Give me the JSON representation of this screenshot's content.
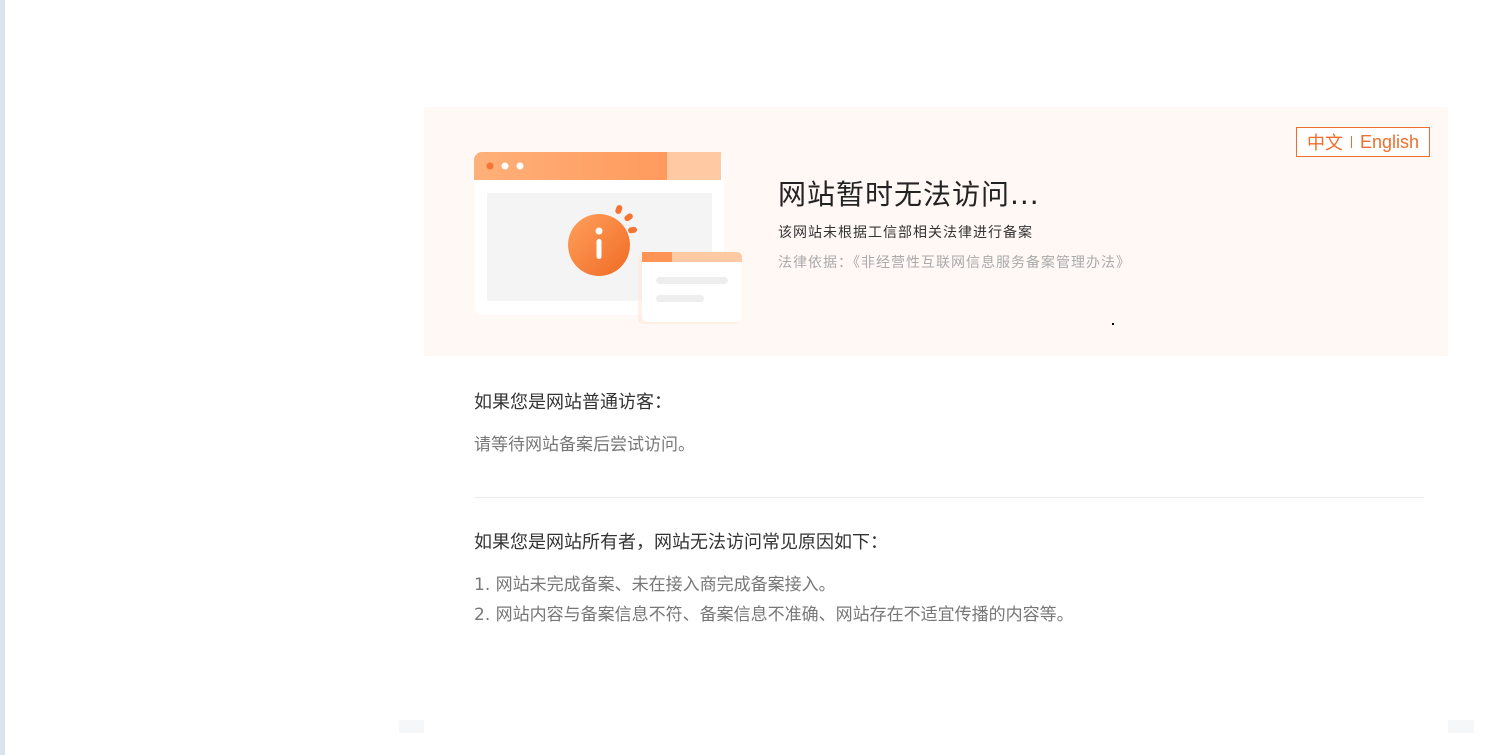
{
  "hero": {
    "title": "网站暂时无法访问...",
    "subtitle": "该网站未根据工信部相关法律进行备案",
    "law": "法律依据：《非经营性互联网信息服务备案管理办法》"
  },
  "lang": {
    "zh": "中文",
    "en": "English"
  },
  "visitor": {
    "title": "如果您是网站普通访客：",
    "body": "请等待网站备案后尝试访问。"
  },
  "owner": {
    "title": "如果您是网站所有者，网站无法访问常见原因如下：",
    "items": [
      "1. 网站未完成备案、未在接入商完成备案接入。",
      "2. 网站内容与备案信息不符、备案信息不准确、网站存在不适宜传播的内容等。"
    ]
  },
  "colors": {
    "accent": "#ee6f2d",
    "hero_bg": "#fff8f5"
  },
  "icons": {
    "illustration": "browser-info-illustration",
    "info": "info-icon"
  }
}
